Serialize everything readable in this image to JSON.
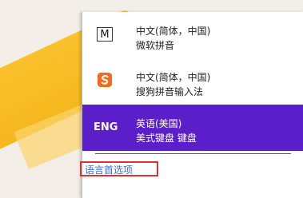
{
  "ime_list": [
    {
      "id": "microsoft-pinyin",
      "badge": "M",
      "line1": "中文(简体，中国)",
      "line2": "微软拼音",
      "active": false
    },
    {
      "id": "sogou-pinyin",
      "badge": "sogou-logo-icon",
      "line1": "中文(简体，中国)",
      "line2": "搜狗拼音输入法",
      "active": false
    },
    {
      "id": "english-us",
      "badge": "ENG",
      "line1": "英语(美国)",
      "line2": "美式键盘 键盘",
      "active": true
    }
  ],
  "language_preferences_link": "语言首选项",
  "colors": {
    "active_bg": "#5b1fc9",
    "link": "#3a6ed6",
    "highlight_box": "#d93434",
    "sogou_orange": "#f26a1b"
  }
}
